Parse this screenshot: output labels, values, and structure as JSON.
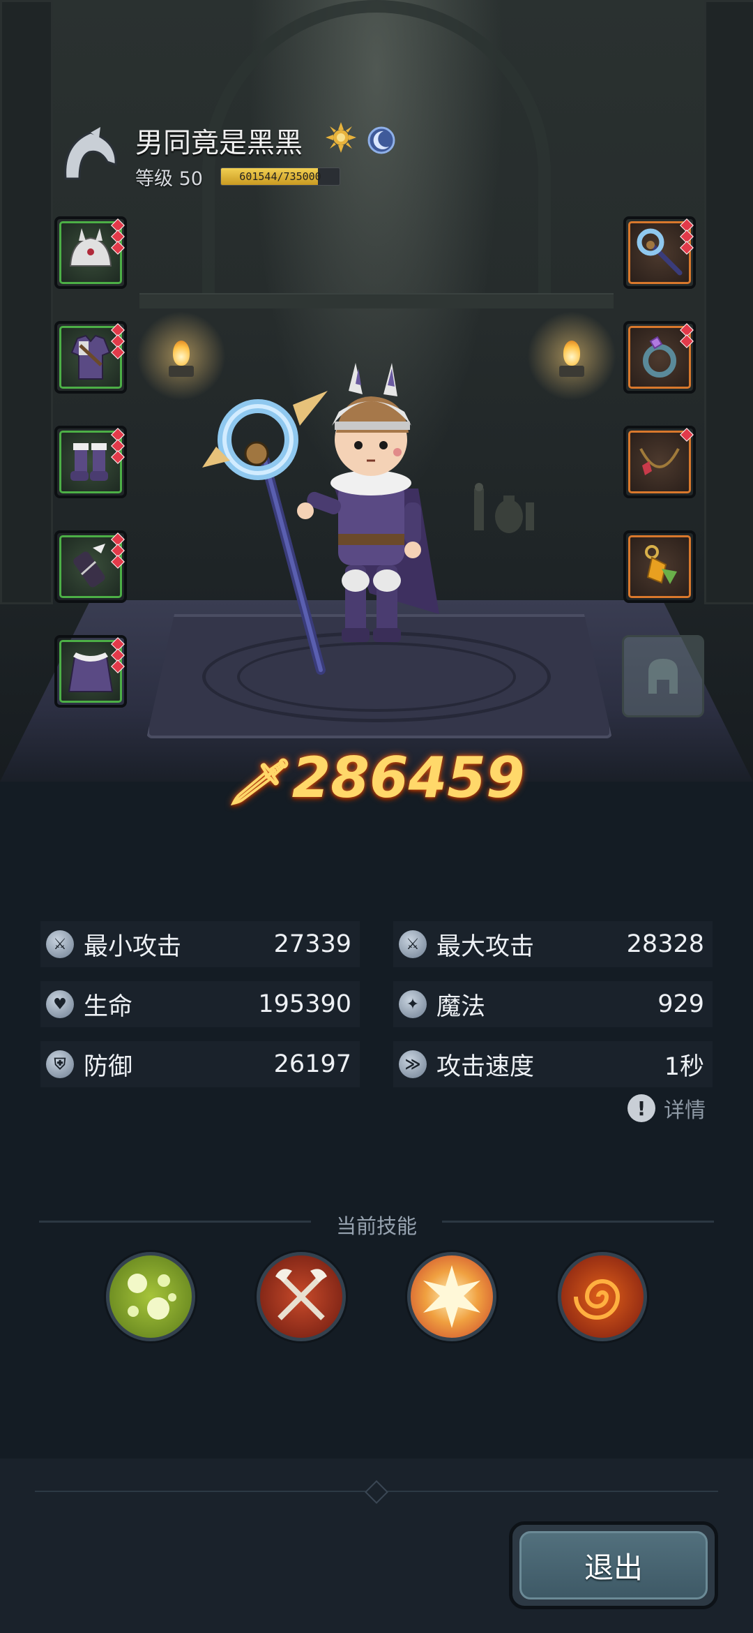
{
  "player": {
    "name": "男同竟是黑黑",
    "level_label": "等级 50",
    "exp_current": 601544,
    "exp_max": 735000,
    "exp_text": "601544/735000"
  },
  "equipment": {
    "left": [
      "helmet",
      "armor",
      "boots",
      "gloves",
      "cloak"
    ],
    "right": [
      "staff",
      "ring",
      "necklace",
      "amulet"
    ]
  },
  "power": {
    "value": "286459"
  },
  "stats": {
    "min_attack": {
      "label": "最小攻击",
      "value": "27339"
    },
    "max_attack": {
      "label": "最大攻击",
      "value": "28328"
    },
    "hp": {
      "label": "生命",
      "value": "195390"
    },
    "mp": {
      "label": "魔法",
      "value": "929"
    },
    "defense": {
      "label": "防御",
      "value": "26197"
    },
    "attack_speed": {
      "label": "攻击速度",
      "value": "1秒"
    }
  },
  "details_label": "详情",
  "skills": {
    "title": "当前技能",
    "items": [
      "poison-bubbles",
      "crossed-axes",
      "explosion",
      "fire-vortex"
    ]
  },
  "footer": {
    "exit_label": "退出"
  },
  "colors": {
    "power": "#ffd86a",
    "slot_green": "#4caf46",
    "slot_orange": "#d9782c",
    "gem": "#e23a4a"
  }
}
